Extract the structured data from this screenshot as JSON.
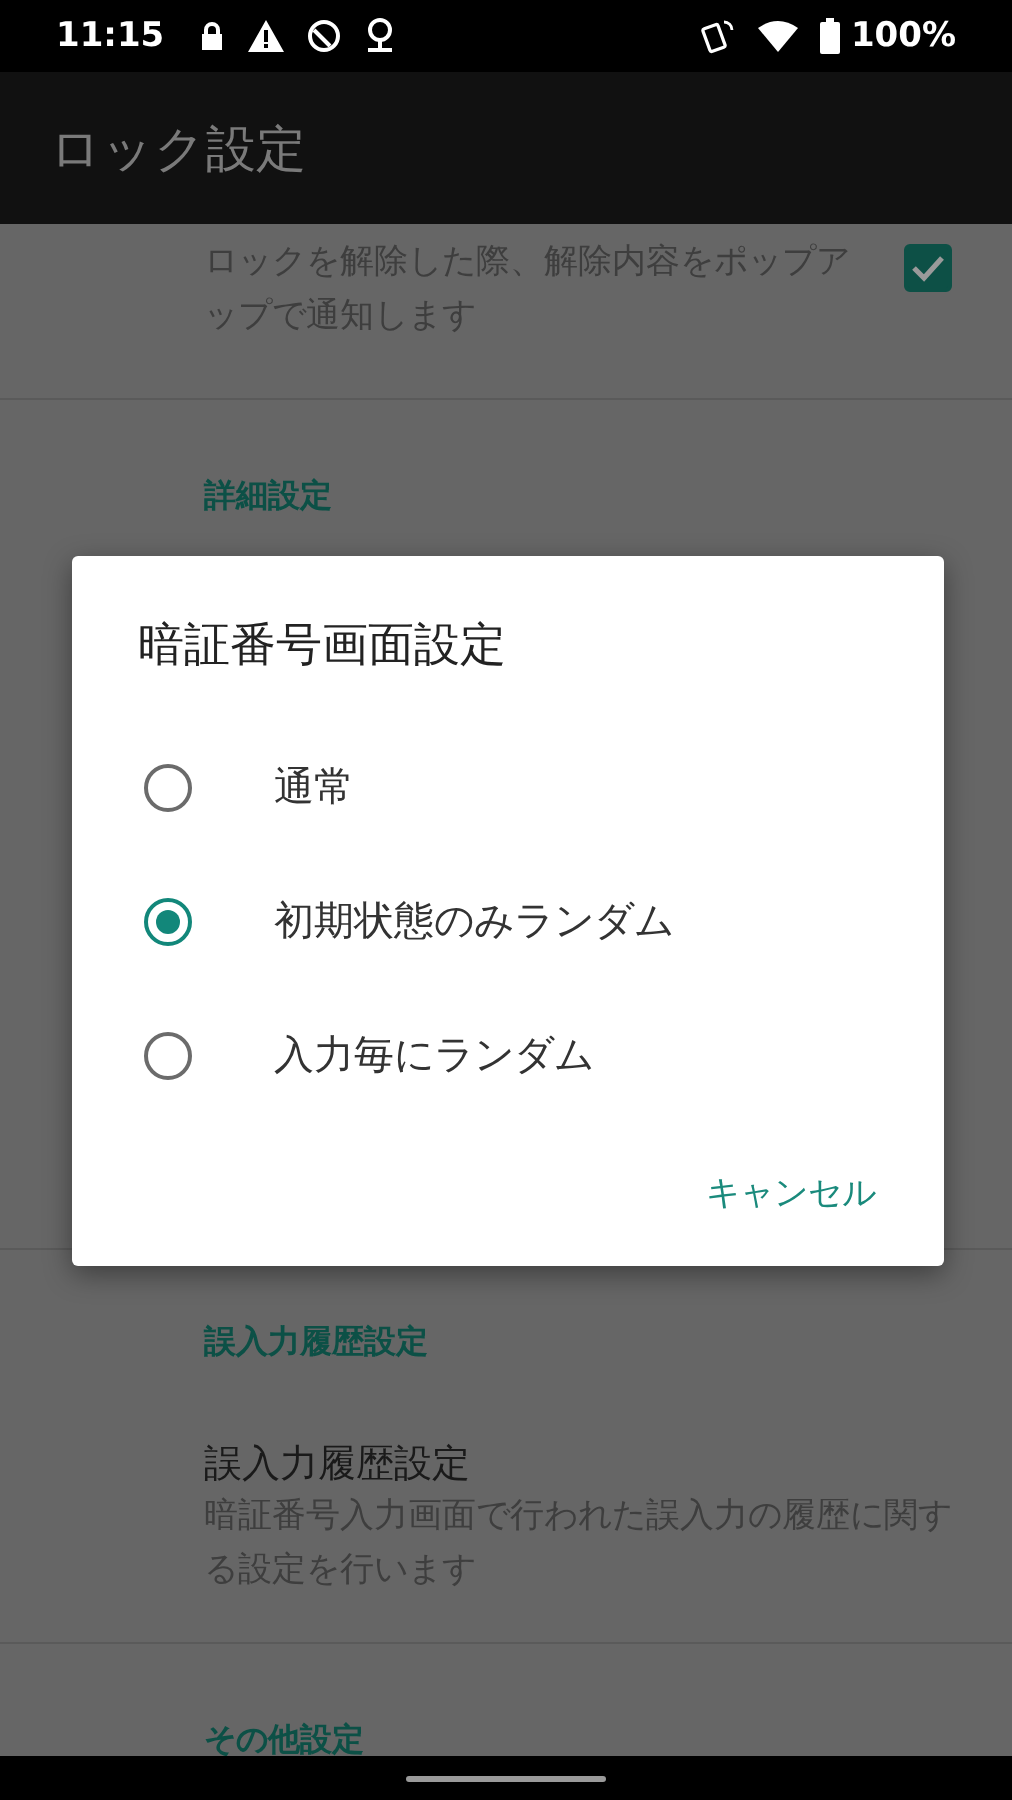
{
  "status_bar": {
    "time": "11:15",
    "battery": "100%"
  },
  "app_bar": {
    "title": "ロック設定"
  },
  "preferences": [
    {
      "kind": "item",
      "summary": "ロックを解除した際、解除内容をポップアップで通知します",
      "checked": true
    },
    {
      "kind": "category",
      "title": "詳細設定"
    },
    {
      "kind": "hidden"
    },
    {
      "kind": "category",
      "title": "誤入力履歴設定"
    },
    {
      "kind": "item",
      "title": "誤入力履歴設定",
      "summary": "暗証番号入力画面で行われた誤入力の履歴に関する設定を行います"
    },
    {
      "kind": "category",
      "title": "その他設定"
    }
  ],
  "dialog": {
    "title": "暗証番号画面設定",
    "options": [
      {
        "label": "通常",
        "selected": false
      },
      {
        "label": "初期状態のみランダム",
        "selected": true
      },
      {
        "label": "入力毎にランダム",
        "selected": false
      }
    ],
    "button": "キャンセル"
  }
}
